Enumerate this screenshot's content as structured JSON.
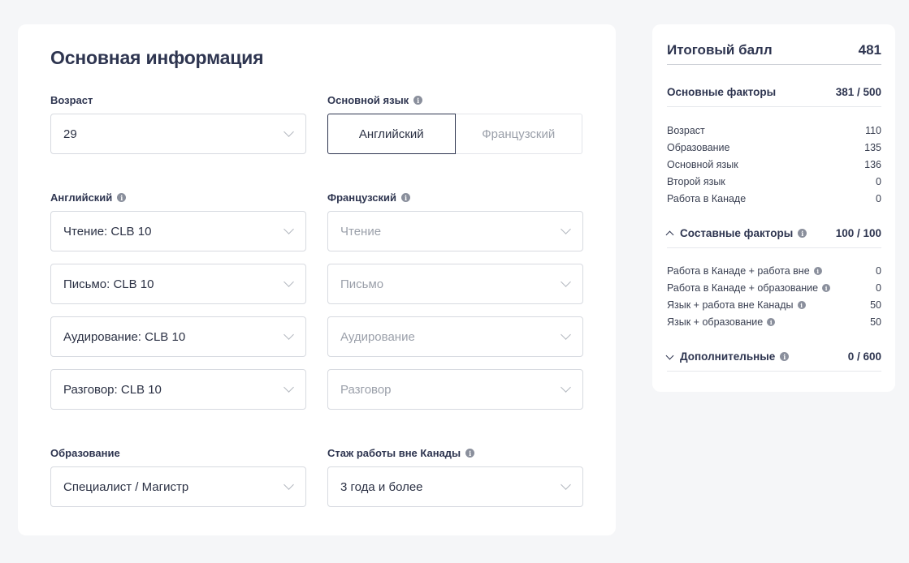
{
  "form": {
    "title": "Основная информация",
    "age": {
      "label": "Возраст",
      "value": "29"
    },
    "primary_language": {
      "label": "Основной язык",
      "options": [
        "Английский",
        "Французский"
      ],
      "selected": "Английский"
    },
    "english": {
      "label": "Английский",
      "reading": "Чтение: CLB 10",
      "writing": "Письмо: CLB 10",
      "listening": "Аудирование: CLB 10",
      "speaking": "Разговор: CLB 10"
    },
    "french": {
      "label": "Французский",
      "reading": "Чтение",
      "writing": "Письмо",
      "listening": "Аудирование",
      "speaking": "Разговор"
    },
    "education": {
      "label": "Образование",
      "value": "Специалист / Магистр"
    },
    "foreign_experience": {
      "label": "Стаж работы вне Канады",
      "value": "3 года и более"
    }
  },
  "summary": {
    "total": {
      "label": "Итоговый балл",
      "value": "481"
    },
    "core": {
      "label": "Основные факторы",
      "value": "381 / 500",
      "items": [
        {
          "label": "Возраст",
          "value": "110"
        },
        {
          "label": "Образование",
          "value": "135"
        },
        {
          "label": "Основной язык",
          "value": "136"
        },
        {
          "label": "Второй язык",
          "value": "0"
        },
        {
          "label": "Работа в Канаде",
          "value": "0"
        }
      ]
    },
    "transferability": {
      "label": "Составные факторы",
      "value": "100 / 100",
      "expanded": true,
      "items": [
        {
          "label": "Работа в Канаде + работа вне",
          "value": "0"
        },
        {
          "label": "Работа в Канаде + образование",
          "value": "0"
        },
        {
          "label": "Язык + работа вне Канады",
          "value": "50"
        },
        {
          "label": "Язык + образование",
          "value": "50"
        }
      ]
    },
    "additional": {
      "label": "Дополнительные",
      "value": "0 / 600",
      "expanded": false
    }
  }
}
